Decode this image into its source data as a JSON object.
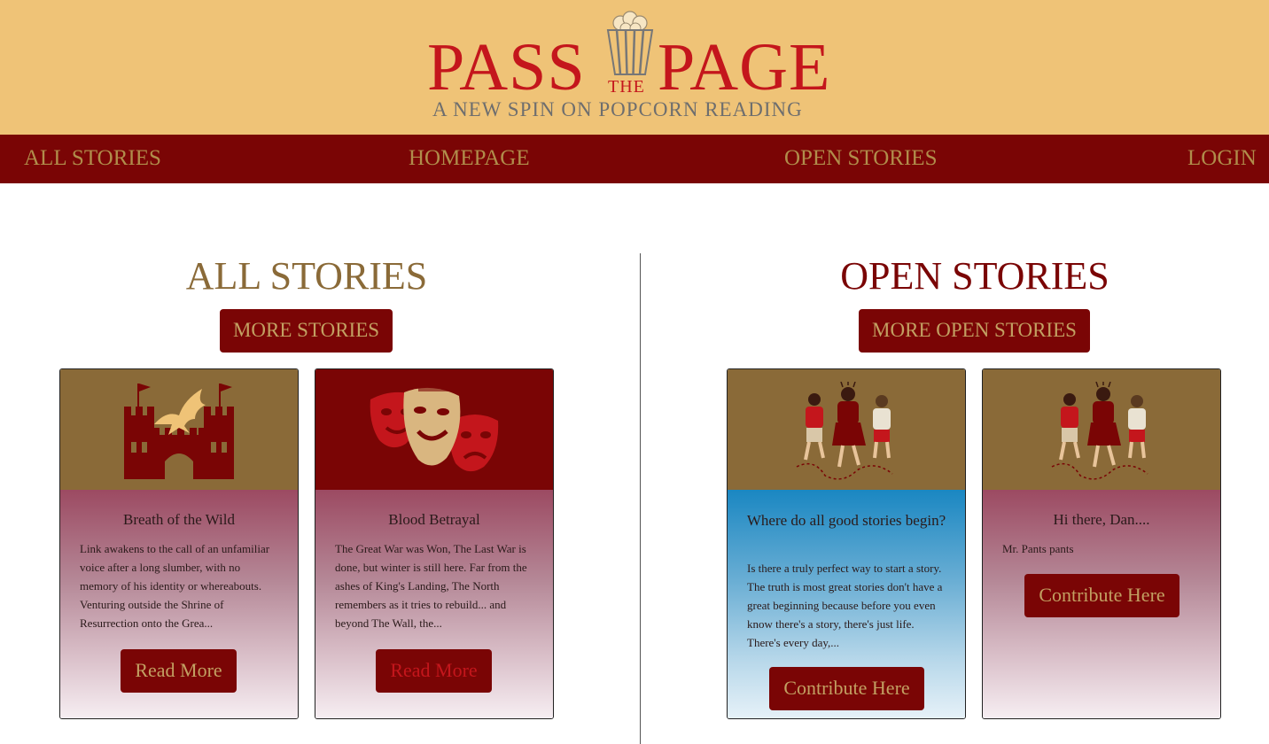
{
  "header": {
    "logo_pass": "PASS",
    "logo_the": "THE",
    "logo_page": "PAGE",
    "logo_tagline": "A NEW SPIN ON POPCORN READING",
    "popcorn_icon": "popcorn-bucket-icon"
  },
  "nav": {
    "all_stories": "ALL STORIES",
    "homepage": "HOMEPAGE",
    "open_stories": "OPEN STORIES",
    "login": "LOGIN"
  },
  "all_stories": {
    "title": "ALL STORIES",
    "more_button": "MORE STORIES",
    "cards": [
      {
        "icon": "castle-dragon-icon",
        "title": "Breath of the Wild",
        "text": "Link awakens to the call of an unfamiliar voice after a long slumber, with no memory of his identity or whereabouts. Venturing outside the Shrine of Resurrection onto the Grea...",
        "button": "Read More"
      },
      {
        "icon": "theater-masks-icon",
        "title": "Blood Betrayal",
        "text": "The Great War was Won, The Last War is done, but winter is still here. Far from the ashes of King's Landing, The North remembers as it tries to rebuild... and beyond The Wall, the...",
        "button": "Read More"
      }
    ]
  },
  "open_stories": {
    "title": "OPEN STORIES",
    "more_button": "MORE OPEN STORIES",
    "cards": [
      {
        "icon": "running-kids-icon",
        "title": "Where do all good stories begin?",
        "text": "Is there a truly perfect way to start a story. The truth is most great stories don't have a great beginning because before you even know there's a story, there's just life. There's every day,...",
        "button": "Contribute Here"
      },
      {
        "icon": "running-kids-icon",
        "title": "Hi there, Dan....",
        "text": "Mr. Pants pants",
        "button": "Contribute Here"
      }
    ]
  },
  "colors": {
    "header_bg": "#efc377",
    "nav_bg": "#7a0505",
    "gold": "#8a6a38",
    "logo_red": "#c4161c"
  }
}
